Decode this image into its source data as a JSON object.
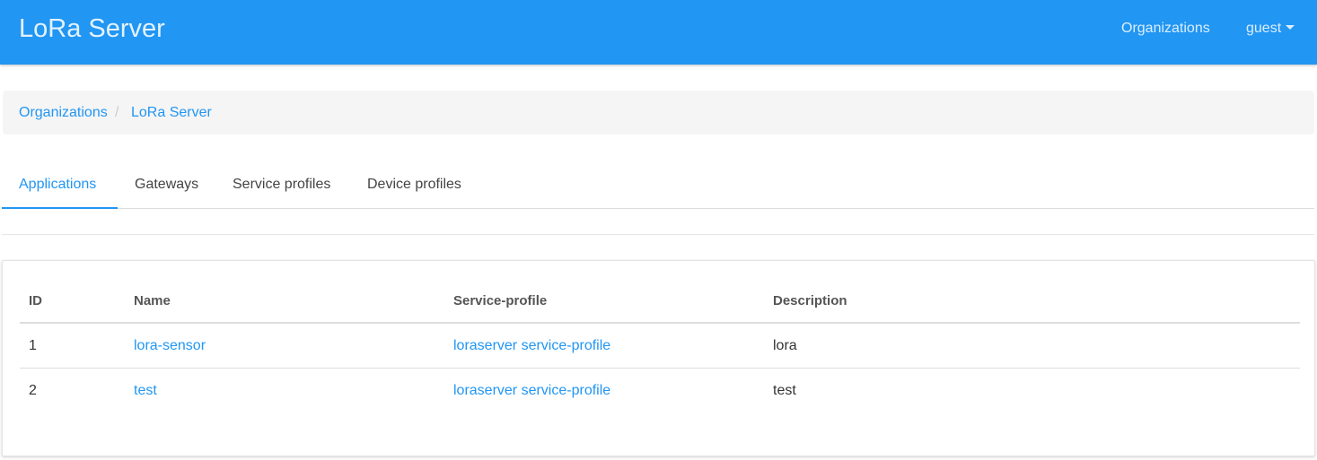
{
  "navbar": {
    "brand": "LoRa Server",
    "organizations_link": "Organizations",
    "user_menu": "guest",
    "color": "#2196f3"
  },
  "breadcrumb": {
    "items": [
      "Organizations",
      "LoRa Server"
    ],
    "separator": "/"
  },
  "tabs": [
    {
      "label": "Applications",
      "active": true
    },
    {
      "label": "Gateways",
      "active": false
    },
    {
      "label": "Service profiles",
      "active": false
    },
    {
      "label": "Device profiles",
      "active": false
    }
  ],
  "table": {
    "columns": [
      "ID",
      "Name",
      "Service-profile",
      "Description"
    ],
    "rows": [
      {
        "id": "1",
        "name": "lora-sensor",
        "service_profile": "loraserver service-profile",
        "description": "lora"
      },
      {
        "id": "2",
        "name": "test",
        "service_profile": "loraserver service-profile",
        "description": "test"
      }
    ]
  },
  "colors": {
    "accent": "#2196f3",
    "breadcrumb_bg": "#f5f5f5"
  }
}
